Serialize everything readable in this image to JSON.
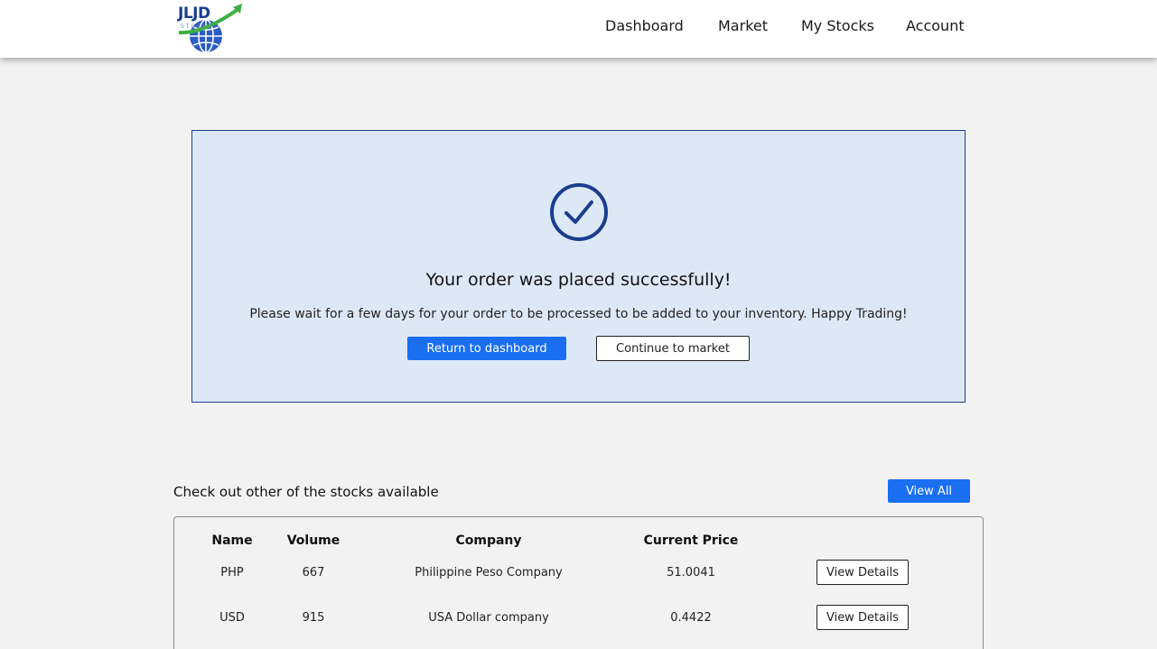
{
  "brand": {
    "logo_text": "JLJD",
    "logo_tagline": "STOCKS",
    "colors": {
      "blue": "#1a3d8f",
      "green": "#3cb043"
    }
  },
  "nav": {
    "items": [
      {
        "label": "Dashboard"
      },
      {
        "label": "Market"
      },
      {
        "label": "My Stocks"
      },
      {
        "label": "Account"
      }
    ]
  },
  "success": {
    "icon": "check-circle-icon",
    "title": "Your order was placed successfully!",
    "message": "Please wait for a few days for your order to be processed to be added to your inventory. Happy Trading!",
    "primary_button": "Return to dashboard",
    "secondary_button": "Continue to market"
  },
  "stocks": {
    "heading": "Check out other of the stocks available",
    "view_all": "View All",
    "columns": [
      "Name",
      "Volume",
      "Company",
      "Current Price"
    ],
    "rows": [
      {
        "name": "PHP",
        "volume": "667",
        "company": "Philippine Peso Company",
        "price": "51.0041",
        "action": "View Details"
      },
      {
        "name": "USD",
        "volume": "915",
        "company": "USA Dollar company",
        "price": "0.4422",
        "action": "View Details"
      }
    ]
  },
  "colors": {
    "accent": "#1a6ff0",
    "panel_bg": "#dde8f7",
    "panel_border": "#1f3f8f",
    "check": "#1a3d8f",
    "page_bg": "#f2f2f2"
  }
}
